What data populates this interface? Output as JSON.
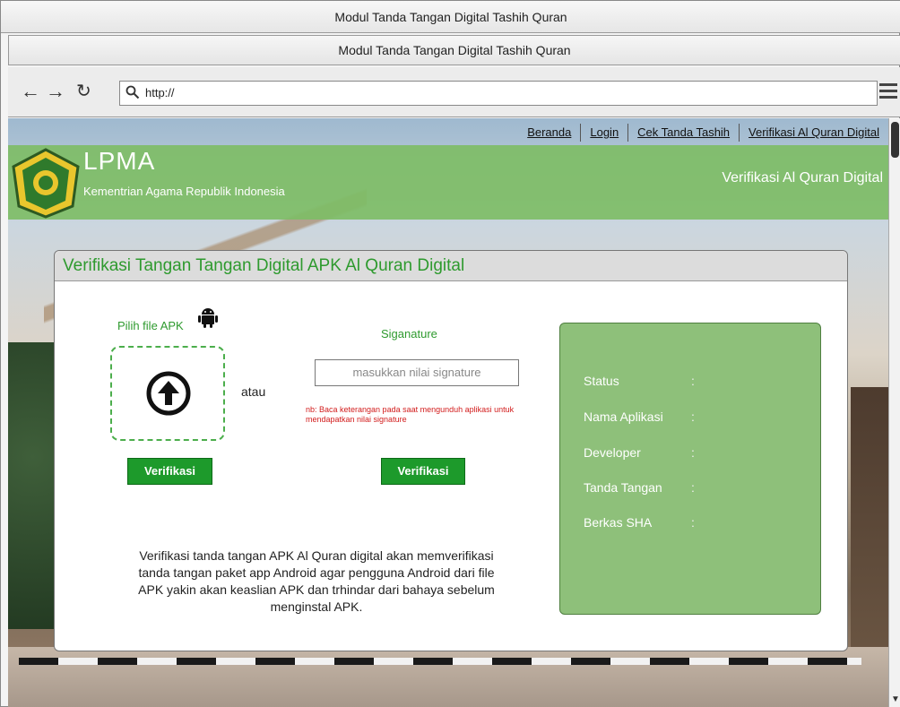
{
  "window": {
    "title": "Modul Tanda Tangan Digital Tashih Quran",
    "tab_title": "Modul Tanda Tangan Digital Tashih Quran"
  },
  "toolbar": {
    "back_icon": "back-arrow-icon",
    "forward_icon": "forward-arrow-icon",
    "reload_icon": "reload-icon",
    "url": "http://",
    "menu_icon": "hamburger-menu-icon"
  },
  "site": {
    "nav": [
      "Beranda",
      "Login",
      "Cek Tanda Tashih",
      "Verifikasi Al Quran Digital"
    ],
    "brand": "LPMA",
    "brand_sub": "Kementrian Agama Republik Indonesia",
    "header_right": "Verifikasi Al Quran Digital",
    "header_color": "#7ebd66"
  },
  "panel": {
    "title": "Verifikasi Tangan Tangan Digital APK Al Quran Digital",
    "apk_label": "Pilih file APK",
    "atau": "atau",
    "verify_button": "Verifikasi",
    "signature_label": "Siganature",
    "signature_placeholder": "masukkan nilai signature",
    "signature_note": "nb: Baca keterangan pada saat mengunduh aplikasi untuk mendapatkan nilai signature",
    "signature_verify_button": "Verifikasi",
    "description": "Verifikasi tanda tangan APK Al Quran digital akan memverifikasi tanda tangan paket app Android agar pengguna Android dari file APK yakin akan keaslian APK dan trhindar dari bahaya sebelum menginstal APK."
  },
  "status": {
    "rows": [
      {
        "label": "Status",
        "sep": ":"
      },
      {
        "label": "Nama Aplikasi",
        "sep": ":"
      },
      {
        "label": "Developer",
        "sep": ":"
      },
      {
        "label": "Tanda Tangan",
        "sep": ":"
      },
      {
        "label": "Berkas SHA",
        "sep": ":"
      }
    ]
  },
  "colors": {
    "accent_green": "#2e9a2e",
    "button_green": "#1d9a2b",
    "status_panel": "#8ec07a",
    "note_red": "#d21c1c"
  }
}
